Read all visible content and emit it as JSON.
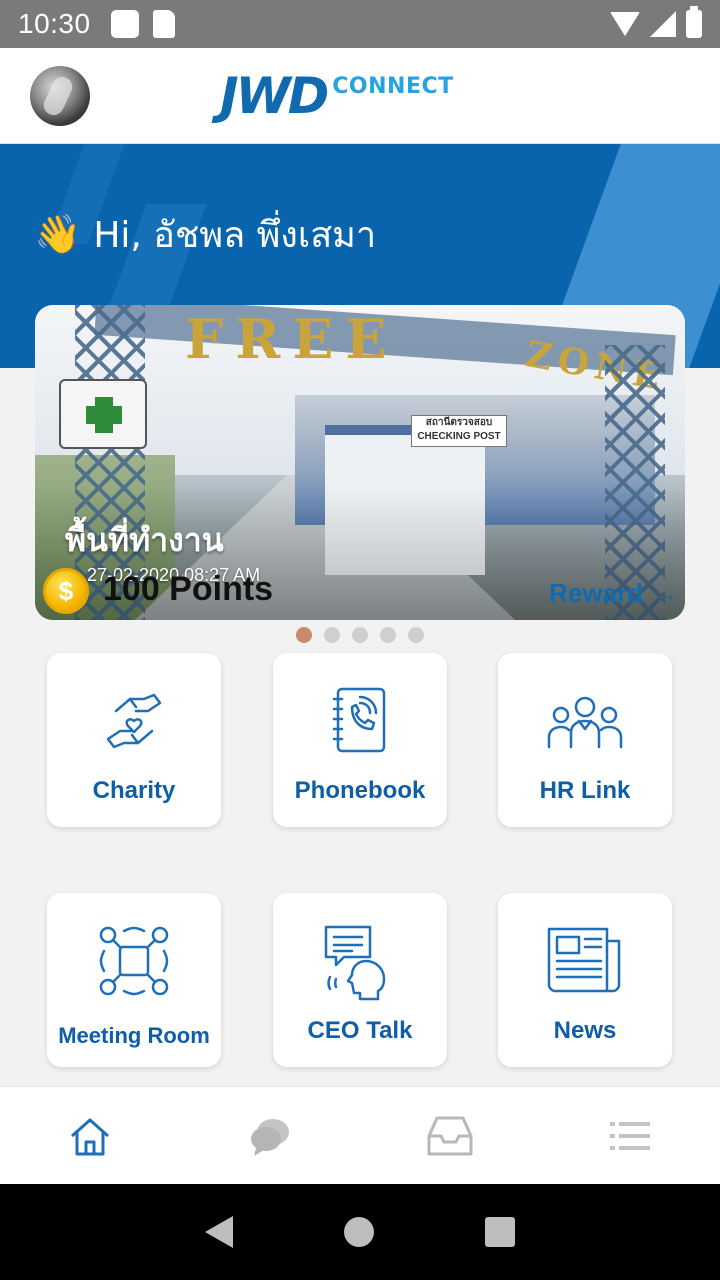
{
  "status_bar": {
    "time": "10:30"
  },
  "header": {
    "logo_main": "JWD",
    "logo_sub": "CONNECT"
  },
  "greeting": {
    "wave": "👋",
    "text": "Hi, อัชพล พึ่งเสมา"
  },
  "carousel": {
    "card": {
      "title": "พื้นที่ทำงาน",
      "date": "27-02-2020 08:27 AM",
      "coin_symbol": "$",
      "points": "100 Points",
      "reward_label": "Reward",
      "reward_arrow": "→",
      "scene_gate_text": "FREE",
      "scene_zone_text": "ZONE",
      "scene_sign_text": "สถานีตรวจสอบ CHECKING POST"
    },
    "page_count": 5,
    "active_page": 1
  },
  "menu": [
    {
      "label": "Charity",
      "icon": "charity-icon"
    },
    {
      "label": "Phonebook",
      "icon": "phonebook-icon"
    },
    {
      "label": "HR Link",
      "icon": "people-icon"
    },
    {
      "label": "Meeting Room",
      "icon": "meeting-room-icon"
    },
    {
      "label": "CEO Talk",
      "icon": "ceo-talk-icon"
    },
    {
      "label": "News",
      "icon": "newspaper-icon"
    }
  ],
  "bottom_nav": [
    {
      "name": "home",
      "icon": "home-icon",
      "active": true
    },
    {
      "name": "chat",
      "icon": "chat-icon",
      "active": false
    },
    {
      "name": "inbox",
      "icon": "inbox-icon",
      "active": false
    },
    {
      "name": "menu",
      "icon": "list-icon",
      "active": false
    }
  ],
  "colors": {
    "brand_blue": "#0f6ab0",
    "hero_blue": "#0a64ad",
    "label_blue": "#0f5ea8",
    "icon_blue": "#1f6fb8",
    "dot_active": "#c98a6e",
    "dot_inactive": "#cfcfcf"
  }
}
